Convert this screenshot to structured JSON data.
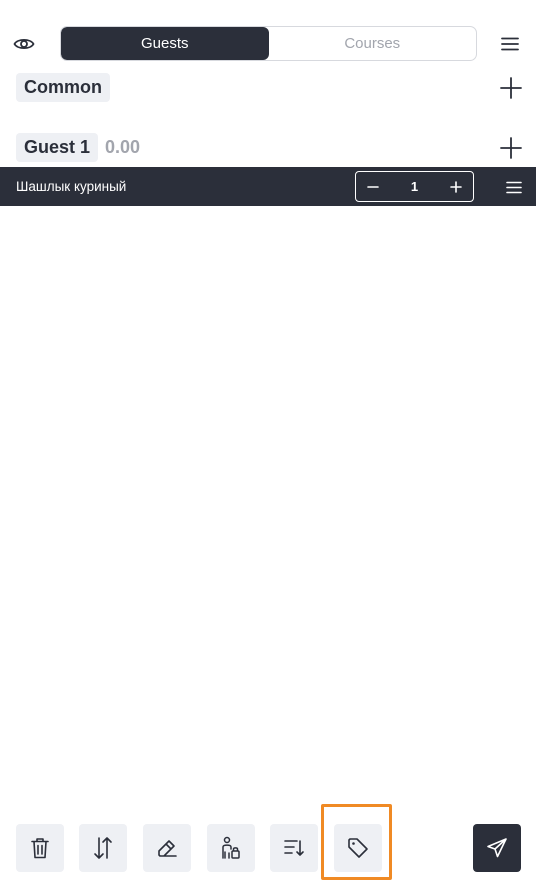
{
  "header": {
    "eye_icon": "eye-icon",
    "tabs": [
      {
        "label": "Guests",
        "active": true
      },
      {
        "label": "Courses",
        "active": false
      }
    ],
    "menu_icon": "hamburger-menu-icon"
  },
  "sections": {
    "common": {
      "label": "Common"
    },
    "guest1": {
      "label": "Guest 1",
      "total": "0.00"
    }
  },
  "order_items": [
    {
      "name": "Шашлык куриный",
      "quantity": "1"
    }
  ],
  "toolbar": {
    "tools": [
      "trash-icon",
      "sort-arrows-icon",
      "eraser-icon",
      "guest-transfer-icon",
      "sort-descending-icon",
      "tag-icon"
    ],
    "highlighted_tool": "tag-icon",
    "send_icon": "send-icon"
  },
  "colors": {
    "dark": "#2b2f3a",
    "chip_bg": "#eef0f4",
    "muted": "#a2a5ad",
    "highlight": "#f08a24"
  }
}
